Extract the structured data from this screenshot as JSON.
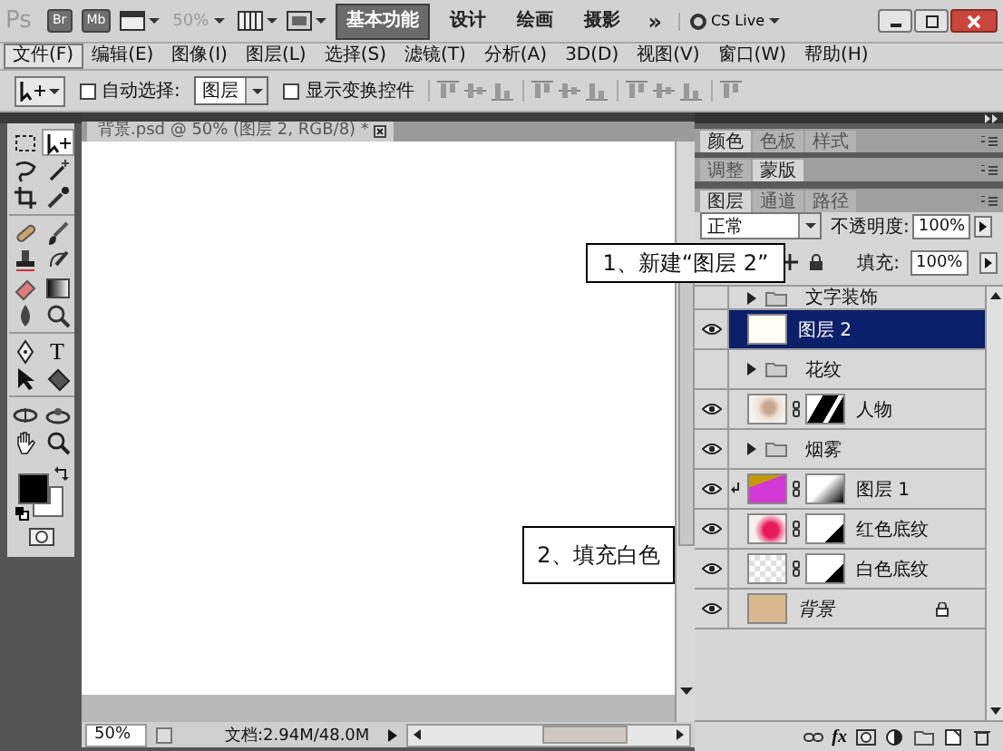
{
  "app_bar": {
    "logo": "Ps",
    "bridge_button": "Br",
    "mini_bridge_button": "Mb",
    "zoom": "50%",
    "workspaces": [
      {
        "label": "基本功能",
        "selected": true
      },
      {
        "label": "设计",
        "selected": false
      },
      {
        "label": "绘画",
        "selected": false
      },
      {
        "label": "摄影",
        "selected": false
      }
    ],
    "more": "»",
    "cs_live": "CS Live"
  },
  "menu": [
    {
      "label": "文件(F)",
      "selected": true
    },
    {
      "label": "编辑(E)",
      "selected": false
    },
    {
      "label": "图像(I)",
      "selected": false
    },
    {
      "label": "图层(L)",
      "selected": false
    },
    {
      "label": "选择(S)",
      "selected": false
    },
    {
      "label": "滤镜(T)",
      "selected": false
    },
    {
      "label": "分析(A)",
      "selected": false
    },
    {
      "label": "3D(D)",
      "selected": false
    },
    {
      "label": "视图(V)",
      "selected": false
    },
    {
      "label": "窗口(W)",
      "selected": false
    },
    {
      "label": "帮助(H)",
      "selected": false
    }
  ],
  "options_bar": {
    "auto_select": {
      "label": "自动选择:",
      "checked": false
    },
    "auto_select_target": "图层",
    "show_transform_controls": {
      "label": "显示变换控件",
      "checked": false
    }
  },
  "tools": [
    {
      "kind": "marquee",
      "selected": false
    },
    {
      "kind": "move",
      "selected": true
    },
    {
      "kind": "lasso",
      "selected": false
    },
    {
      "kind": "wand",
      "selected": false
    },
    {
      "kind": "crop",
      "selected": false
    },
    {
      "kind": "eyedropper",
      "selected": false
    },
    {
      "kind": "healing",
      "selected": false
    },
    {
      "kind": "brush",
      "selected": false
    },
    {
      "kind": "stamp",
      "selected": false
    },
    {
      "kind": "history-brush",
      "selected": false
    },
    {
      "kind": "eraser",
      "selected": false
    },
    {
      "kind": "gradient",
      "selected": false
    },
    {
      "kind": "blur",
      "selected": false
    },
    {
      "kind": "dodge",
      "selected": false
    },
    {
      "kind": "pen",
      "selected": false
    },
    {
      "kind": "type",
      "label": "T",
      "selected": false
    },
    {
      "kind": "path-select",
      "selected": false
    },
    {
      "kind": "shape",
      "selected": false
    },
    {
      "kind": "rotate-3d",
      "selected": false
    },
    {
      "kind": "orbit-3d",
      "selected": false
    },
    {
      "kind": "hand",
      "selected": false
    },
    {
      "kind": "zoom",
      "selected": false
    }
  ],
  "swatches": {
    "foreground": {
      "color": "#000000"
    },
    "background": {
      "color": "#ffffff"
    }
  },
  "document": {
    "tab_title": "背景.psd @ 50% (图层 2, RGB/8) *"
  },
  "status_bar": {
    "zoom": "50%",
    "doc_info": "文档:2.94M/48.0M"
  },
  "panel_groups": [
    {
      "tabs": [
        {
          "label": "颜色",
          "selected": true
        },
        {
          "label": "色板",
          "selected": false
        },
        {
          "label": "样式",
          "selected": false
        }
      ]
    },
    {
      "tabs": [
        {
          "label": "调整",
          "selected": false
        },
        {
          "label": "蒙版",
          "selected": true
        }
      ]
    },
    {
      "tabs": [
        {
          "label": "图层",
          "selected": true
        },
        {
          "label": "通道",
          "selected": false
        },
        {
          "label": "路径",
          "selected": false
        }
      ]
    }
  ],
  "layers_panel": {
    "blend_mode": "正常",
    "opacity_label": "不透明度:",
    "opacity": "100%",
    "fill_label": "填充:",
    "fill": "100%",
    "styles_button": "fx",
    "layers": [
      {
        "name": "文字装饰",
        "kind": "group",
        "expanded": false,
        "visible": false,
        "selected": false,
        "clipped": false,
        "locked": false
      },
      {
        "name": "图层 2",
        "kind": "layer",
        "thumbnail": {
          "kind": "white"
        },
        "visible": true,
        "selected": true,
        "clipped": false,
        "locked": false
      },
      {
        "name": "花纹",
        "kind": "group",
        "expanded": false,
        "visible": false,
        "selected": false,
        "clipped": false,
        "locked": false
      },
      {
        "name": "人物",
        "kind": "layer",
        "thumbnail": {
          "kind": "sketch"
        },
        "mask": {
          "kind": "figure"
        },
        "visible": true,
        "selected": false,
        "clipped": false,
        "locked": false
      },
      {
        "name": "烟雾",
        "kind": "group",
        "expanded": false,
        "visible": true,
        "selected": false,
        "clipped": false,
        "locked": false
      },
      {
        "name": "图层 1",
        "kind": "layer",
        "thumbnail": {
          "kind": "magenta"
        },
        "mask": {
          "kind": "gradient"
        },
        "visible": true,
        "selected": false,
        "clipped": true,
        "locked": false
      },
      {
        "name": "红色底纹",
        "kind": "layer",
        "thumbnail": {
          "kind": "splash"
        },
        "mask": {
          "kind": "corner"
        },
        "visible": true,
        "selected": false,
        "clipped": false,
        "locked": false
      },
      {
        "name": "白色底纹",
        "kind": "layer",
        "thumbnail": {
          "kind": "transparent"
        },
        "mask": {
          "kind": "corner"
        },
        "visible": true,
        "selected": false,
        "clipped": false,
        "locked": false
      },
      {
        "name": "背景",
        "kind": "background",
        "thumbnail": {
          "kind": "texture"
        },
        "visible": true,
        "selected": false,
        "clipped": false,
        "locked": true
      }
    ]
  },
  "callouts": [
    {
      "text": "1、新建“图层 2”"
    },
    {
      "text": "2、填充白色"
    }
  ]
}
